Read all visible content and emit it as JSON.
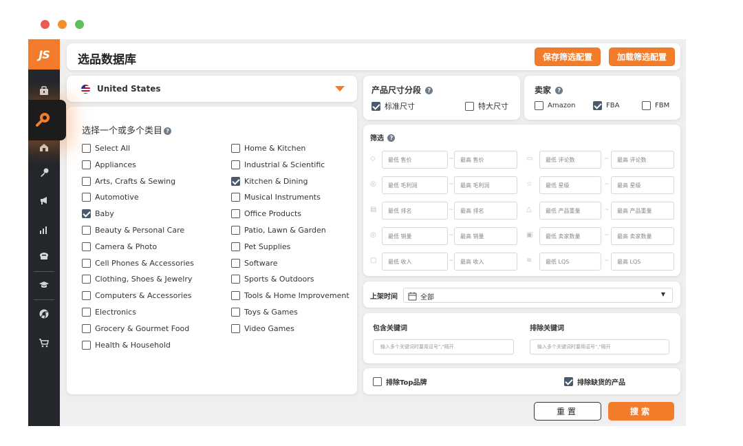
{
  "colors": {
    "accent": "#f27c2a",
    "sidebar": "#23262b",
    "window_bg": "#efefef",
    "traffic_red": "#ec5a4f",
    "traffic_orange": "#f2902a",
    "traffic_green": "#5cc156"
  },
  "sidebar": {
    "logo": "JS",
    "icons": [
      "briefcase-icon",
      "search-icon",
      "house-icon",
      "key-icon",
      "megaphone-icon",
      "bar-chart-icon",
      "hat-icon",
      "graduation-cap-icon",
      "chrome-icon",
      "cart-icon"
    ]
  },
  "header": {
    "title": "选品数据库",
    "save_label": "保存筛选配置",
    "load_label": "加载筛选配置"
  },
  "country": {
    "selected": "United States"
  },
  "categories": {
    "title": "选择一个或多个类目",
    "left": [
      {
        "label": "Select All",
        "checked": false
      },
      {
        "label": "Appliances",
        "checked": false
      },
      {
        "label": "Arts, Crafts & Sewing",
        "checked": false
      },
      {
        "label": "Automotive",
        "checked": false
      },
      {
        "label": "Baby",
        "checked": true
      },
      {
        "label": "Beauty & Personal Care",
        "checked": false
      },
      {
        "label": "Camera & Photo",
        "checked": false
      },
      {
        "label": "Cell Phones & Accessories",
        "checked": false
      },
      {
        "label": "Clothing, Shoes & Jewelry",
        "checked": false
      },
      {
        "label": "Computers & Accessories",
        "checked": false
      },
      {
        "label": "Electronics",
        "checked": false
      },
      {
        "label": "Grocery & Gourmet Food",
        "checked": false
      },
      {
        "label": "Health & Household",
        "checked": false
      }
    ],
    "right": [
      {
        "label": "Home & Kitchen",
        "checked": false
      },
      {
        "label": "Industrial & Scientific",
        "checked": false
      },
      {
        "label": "Kitchen & Dining",
        "checked": true
      },
      {
        "label": "Musical Instruments",
        "checked": false
      },
      {
        "label": "Office Products",
        "checked": false
      },
      {
        "label": "Patio, Lawn & Garden",
        "checked": false
      },
      {
        "label": "Pet Supplies",
        "checked": false
      },
      {
        "label": "Software",
        "checked": false
      },
      {
        "label": "Sports & Outdoors",
        "checked": false
      },
      {
        "label": "Tools & Home Improvement",
        "checked": false
      },
      {
        "label": "Toys & Games",
        "checked": false
      },
      {
        "label": "Video Games",
        "checked": false
      }
    ]
  },
  "size": {
    "title": "产品尺寸分段",
    "options": [
      {
        "label": "标准尺寸",
        "checked": true
      },
      {
        "label": "特大尺寸",
        "checked": false
      }
    ]
  },
  "seller": {
    "title": "卖家",
    "options": [
      {
        "label": "Amazon",
        "checked": false
      },
      {
        "label": "FBA",
        "checked": true
      },
      {
        "label": "FBM",
        "checked": false
      }
    ]
  },
  "filter": {
    "title": "筛选",
    "rows": [
      {
        "left_icon": "price-tag-icon",
        "left_min": "最低 售价",
        "left_max": "最高 售价",
        "right_icon": "review-icon",
        "right_min": "最低 评论数",
        "right_max": "最高 评论数"
      },
      {
        "left_icon": "profit-icon",
        "left_min": "最低 毛利润",
        "left_max": "最高 毛利润",
        "right_icon": "star-icon",
        "right_min": "最低 星级",
        "right_max": "最高 星级"
      },
      {
        "left_icon": "rank-icon",
        "left_min": "最低 排名",
        "left_max": "最高 排名",
        "right_icon": "weight-icon",
        "right_min": "最低 产品重量",
        "right_max": "最高 产品重量"
      },
      {
        "left_icon": "sales-icon",
        "left_min": "最低 销量",
        "left_max": "最高 销量",
        "right_icon": "sellers-icon",
        "right_min": "最低 卖家数量",
        "right_max": "最高 卖家数量"
      },
      {
        "left_icon": "revenue-icon",
        "left_min": "最低 收入",
        "left_max": "最高 收入",
        "right_icon": "lqs-icon",
        "right_min": "最低 LQS",
        "right_max": "最高 LQS"
      }
    ]
  },
  "date": {
    "label": "上架时间",
    "value": "全部"
  },
  "keywords": {
    "include_label": "包含关键词",
    "exclude_label": "排除关键词",
    "include_placeholder": "输入多个关键词时要用逗号\",\"隔开",
    "exclude_placeholder": "输入多个关键词时要用逗号\",\"隔开"
  },
  "exclusions": {
    "top_brand": {
      "label": "排除Top品牌",
      "checked": false
    },
    "out_of_stock": {
      "label": "排除缺货的产品",
      "checked": true
    }
  },
  "actions": {
    "reset": "重置",
    "search": "搜索"
  }
}
